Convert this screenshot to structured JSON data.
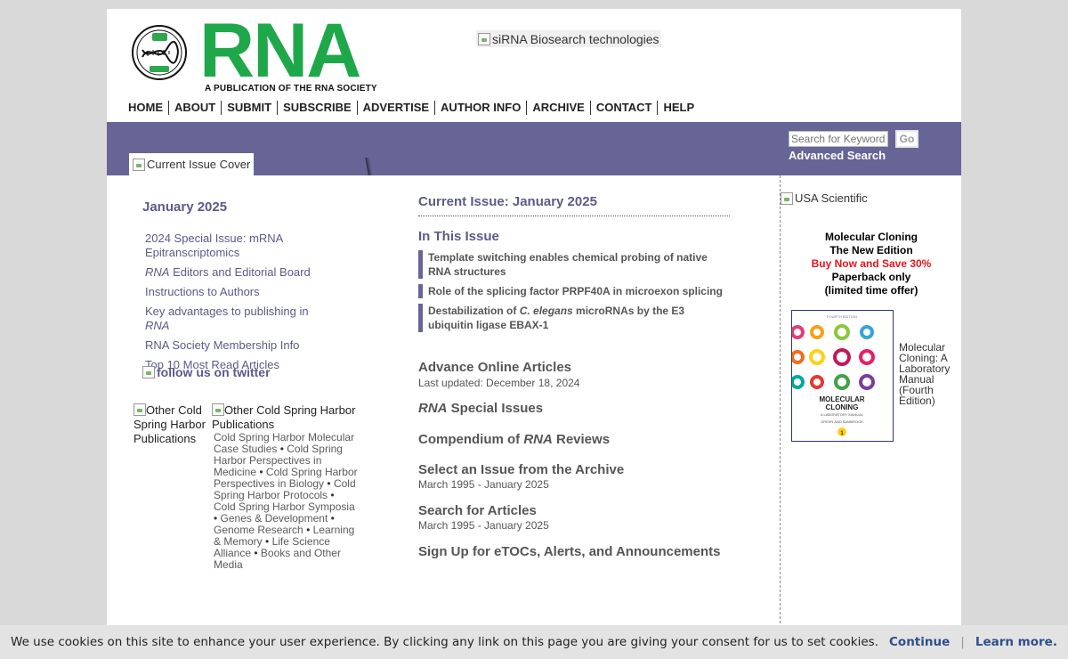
{
  "header": {
    "seal_text": "RNA SOCIETY",
    "wordmark": "RNA",
    "tagline": "A PUBLICATION OF THE RNA SOCIETY",
    "banner_ad_alt": "siRNA Biosearch technologies",
    "nav": [
      "HOME",
      "ABOUT",
      "SUBMIT",
      "SUBSCRIBE",
      "ADVERTISE",
      "AUTHOR INFO",
      "ARCHIVE",
      "CONTACT",
      "HELP"
    ]
  },
  "search": {
    "placeholder": "Search for Keyword:",
    "go_label": "Go",
    "advanced_label": "Advanced Search"
  },
  "cover_alt": "Current Issue Cover",
  "left": {
    "issue_title": "January 2025",
    "links": {
      "special_issue": "2024 Special Issue: mRNA Epitranscriptomics",
      "editors_em": "RNA",
      "editors_rest": " Editors and Editorial Board",
      "instructions": "Instructions to Authors",
      "advantages_prefix": "Key advantages to publishing in ",
      "advantages_em": "RNA",
      "membership": "RNA Society Membership Info",
      "top10": "Top 10 Most Read Articles"
    },
    "twitter_alt": "follow us on twitter",
    "cshl_left_alt": "Other Cold Spring Harbor Publications",
    "cshl_right_alt": "Other Cold Spring Harbor Publications",
    "publications": [
      "Cold Spring Harbor Molecular Case Studies",
      "Cold Spring Harbor Perspectives in Medicine",
      "Cold Spring Harbor Perspectives in Biology",
      "Cold Spring Harbor Protocols",
      "Cold Spring Harbor Symposia",
      "Genes & Development",
      "Genome Research",
      "Learning & Memory",
      "Life Science Alliance",
      "Books and Other Media"
    ]
  },
  "center": {
    "current_issue": "Current Issue: January 2025",
    "in_this_issue": "In This Issue",
    "articles": {
      "a1": "Template switching enables chemical probing of native RNA structures",
      "a2": "Role of the splicing factor PRPF40A in microexon splicing",
      "a3_prefix": "Destabilization of ",
      "a3_em": "C. elegans",
      "a3_rest": " microRNAs by the E3 ubiquitin ligase EBAX-1"
    },
    "advance": "Advance Online Articles",
    "advance_updated": "Last updated: December 18, 2024",
    "special_em": "RNA",
    "special_rest": " Special Issues",
    "compendium_prefix": "Compendium of ",
    "compendium_em": "RNA",
    "compendium_rest": " Reviews",
    "archive": "Select an Issue from the Archive",
    "archive_range": "March 1995 - January 2025",
    "search_articles": "Search for Articles",
    "search_range": "March 1995 - January 2025",
    "signup": "Sign Up for eTOCs, Alerts, and Announcements"
  },
  "right": {
    "usa_alt": "USA Scientific",
    "promo_l1": "Molecular Cloning",
    "promo_l2": "The New Edition",
    "promo_l3": "Buy Now and Save 30%",
    "promo_l4": "Paperback only",
    "promo_l5": "(limited time offer)",
    "book_edition": "FOURTH EDITION",
    "book_title_1": "MOLECULAR",
    "book_title_2": "CLONING",
    "book_subtitle": "A LABORATORY MANUAL",
    "book_authors": "GREEN AND SAMBROOK",
    "book_volume": "1",
    "caption": "Molecular Cloning: A Laboratory Manual (Fourth Edition)"
  },
  "cookie": {
    "message": "We use cookies on this site to enhance your user experience. By clicking any link on this page you are giving your consent for us to set cookies.",
    "continue": "Continue",
    "separator": "|",
    "learn_more": "Learn more."
  },
  "colors": {
    "brand_green": "#1fa84a",
    "purple": "#676596",
    "link_purple": "#5b5a8a",
    "promo_red": "#e8141b"
  }
}
